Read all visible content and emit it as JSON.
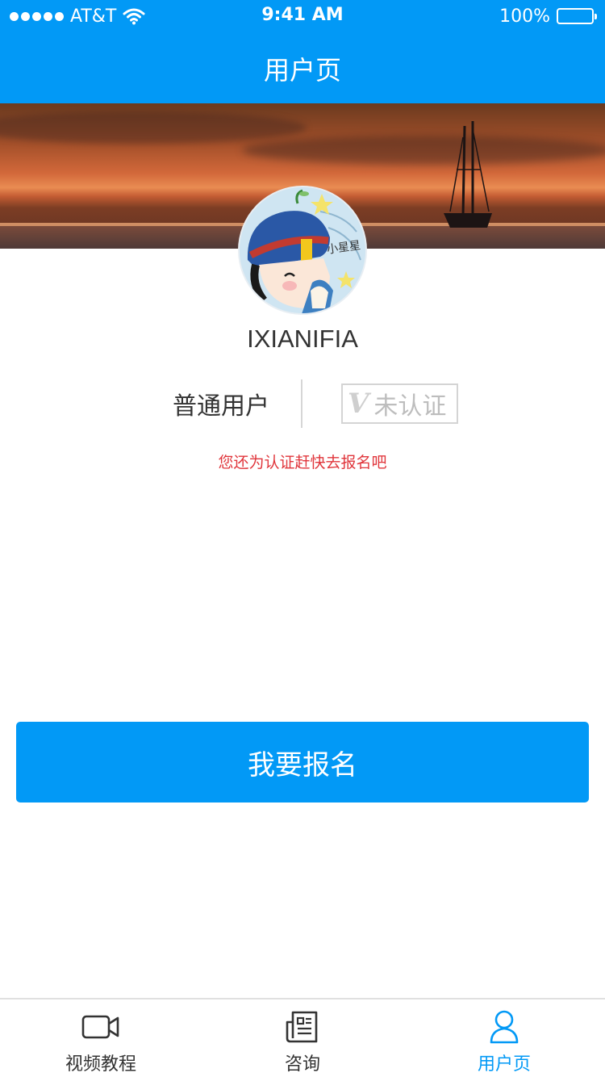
{
  "status_bar": {
    "carrier": "AT&T",
    "time": "9:41 AM",
    "battery": "100%",
    "battery_level": 1.0
  },
  "nav": {
    "title": "用户页"
  },
  "profile": {
    "avatar_tag": "小星星",
    "username": "IXIANIFIA",
    "user_type": "普通用户",
    "cert_label": "未认证",
    "hint": "您还为认证赶快去报名吧"
  },
  "signup_button": "我要报名",
  "tabs": [
    {
      "label": "视频教程",
      "icon": "video-camera-icon",
      "active": false
    },
    {
      "label": "咨询",
      "icon": "news-document-icon",
      "active": false
    },
    {
      "label": "用户页",
      "icon": "user-person-icon",
      "active": true
    }
  ],
  "colors": {
    "primary": "#0299f6",
    "hint": "#e0353b",
    "active_tab": "#0299f6"
  }
}
